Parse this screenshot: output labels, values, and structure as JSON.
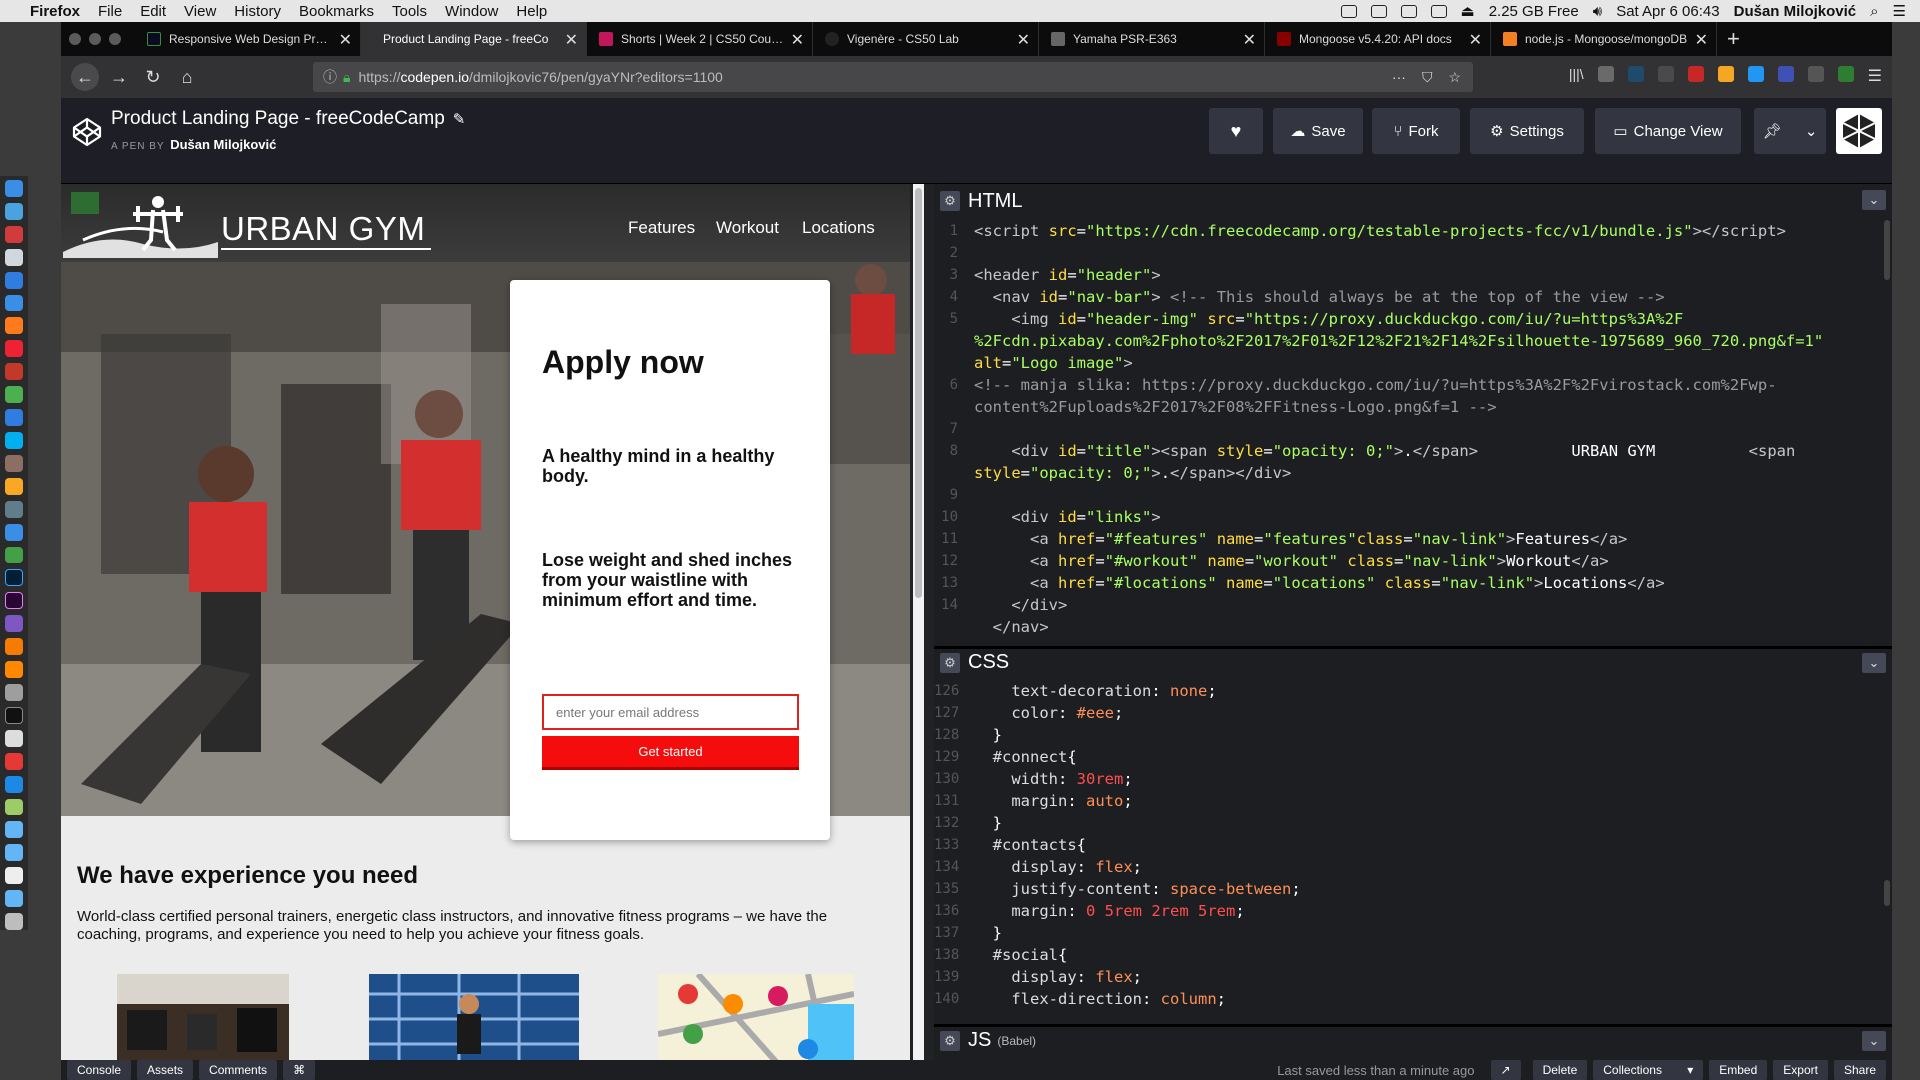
{
  "menubar": {
    "app": "Firefox",
    "items": [
      "File",
      "Edit",
      "View",
      "History",
      "Bookmarks",
      "Tools",
      "Window",
      "Help"
    ],
    "disk": "2.25 GB Free",
    "datetime": "Sat Apr 6  06:43",
    "user": "Dušan Milojković"
  },
  "tabs": [
    {
      "label": "Responsive Web Design Projec"
    },
    {
      "label": "Product Landing Page - freeCo"
    },
    {
      "label": "Shorts | Week 2 | CS50 Course"
    },
    {
      "label": "Vigenère - CS50 Lab"
    },
    {
      "label": "Yamaha PSR-E363"
    },
    {
      "label": "Mongoose v5.4.20: API docs"
    },
    {
      "label": "node.js - Mongoose/mongoDB"
    }
  ],
  "url": {
    "scheme": "https://",
    "host": "codepen.io",
    "path": "/dmilojkovic76/pen/gyaYNr?editors=1100"
  },
  "codepen": {
    "title": "Product Landing Page - freeCodeCamp",
    "by": "A PEN BY",
    "author": "Dušan Milojković",
    "buttons": {
      "save": "Save",
      "fork": "Fork",
      "settings": "Settings",
      "change_view": "Change View"
    }
  },
  "preview": {
    "brand": "URBAN GYM",
    "nav": [
      "Features",
      "Workout",
      "Locations"
    ],
    "apply_title": "Apply now",
    "tagline1": "A healthy mind in a healthy body.",
    "tagline2": "Lose weight and shed inches from your waistline with minimum effort and time.",
    "email_placeholder": "enter your email address",
    "cta": "Get started",
    "exp_title": "We have experience you need",
    "exp_body": "World-class certified personal trainers, energetic class instructors, and innovative fitness programs – we have the coaching, programs, and experience you need to help you achieve your fitness goals."
  },
  "editors": {
    "html_label": "HTML",
    "css_label": "CSS",
    "js_label": "JS",
    "js_sub": "(Babel)"
  },
  "footer": {
    "console": "Console",
    "assets": "Assets",
    "comments": "Comments",
    "cmd": "⌘",
    "last_saved": "Last saved less than a minute ago",
    "delete": "Delete",
    "collections": "Collections",
    "embed": "Embed",
    "export": "Export",
    "share": "Share"
  },
  "colors": {
    "accent_red": "#f50c0c",
    "editor_bg": "#1d1e22",
    "header_bg": "#1e1f26"
  }
}
